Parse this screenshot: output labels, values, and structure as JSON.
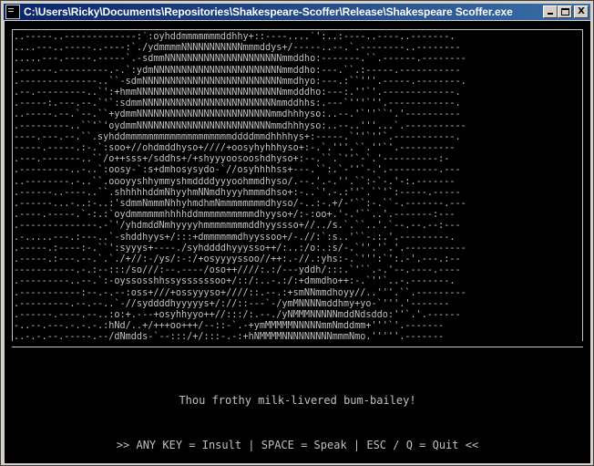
{
  "window": {
    "title": "C:\\Users\\Ricky\\Documents\\Repositories\\Shakespeare-Scoffer\\Release\\Shakespeare Scoffer.exe",
    "buttons": {
      "minimize": "minimize-icon",
      "maximize": "maximize-icon",
      "close_label": "X"
    }
  },
  "console": {
    "ascii_art": "..-----..-------------:`:oyhddmmmmmmmddhhy+::----....`':..:----..----..-------.\n....---..-----..----:`./ydmmmmNNNNNNNNNNNmmmddys+/-----..--.`.--------..--------\n.....---.-----.-----`.-sdmmNNNNNNNNNNNNNNNNNNNNNmmddho:-------.``.------.--------\n.------.---------.-.`:ydmNNNNNNNNNNNNNNNNNNNNNNNmmddho:---.``.:-----.-----------\n.--------------..``-sdmNNNNNNNNNNNNNNNNNNNNNNNNNmmdhyo:---.:``'''.-----.--------.\n.--.---------..`':+hmmNNNNNNNNNNNNNNNNNNNNNNNNNNmmdddho:---:.''`'.-------------.\n.-----:.---.--.`'`:sdmmNNNNNNNNNNNNNNNNNNNNNNNNmmddhhs:.---`'''`''.------------.\n..-----.--.`--.``+ydmmNNNNNNNNNNNNNNNNNNNNNNNNmmdhhhyso:..--.'`''``'.'----------\n.---------..``'`'oydmmNNNNNNNNNNNNNNNNNNNNNNNNmmdhhhyso:..--..'''...`.-----------\n----.---.--.``.syhddmmmmmmmmmmmmmmmmmmmddddmmdhhhhys+:-----.`''`''`.-----------.\n-----.-----.:-.`:soo+//ohdmddhyso+////+oosyhyhhhyso+:-.`.'''.``.''`'.----------\n.---.-------..``/o++sss+/sddhs+/+shyyyoosooshdhyso+:--.``.`''`-`.'----------:-\n.---------..-..`:oosy-`:s+dmhosysydo-`//osyhhhhss+---.``:.`-''`-.'.---------.---\n..--------.-..``.oooyyshhymmyshmddddyyyoohmmdhyso/.--.'.-.''.``:-`-.'-:.-------\n.------..----..``.shhhhhddmNhyyhmNNmdhyyyhmmmdhso+:-..`'.-.:''`.``'`:-----.-----\n.------...-..:-..:'sdmmNmmmNhhyhmdhmNmmmmmmmmdhyso/-..:-.+/-'``:-.``-.-------.---\n.----.-----.`-:.:`oydmmmmmmhhhhddmmmmmmmmmmdhyyso+/:-:oo+.'-.'``..'.-------:---\n.--------------.-`'/yhdmddNmhyyyyhmmmmmmmmddhyyssso+//../s.`.``..'.`--.--.--:---\n.-.....---.:---..`-shddhyys+/:::+dmmmmmmdhyyssoo+/-.//:`:s..'``-.:.'.---------.\n.-----.:----:-.``':syyys+----./syhddddhyyysso++/:..:/o:.:s/-.`''.'`.'.-----------\n.-----.:---.--.`.`./+//:-/ys/:-:/+osyyyyssoo//++:.-//.:yhs:-.`''':`':.-'.---.:--\n-----------.-.:--:::/so///:--.----/oso++////:.:/---yddh/:::.`'``.-.'--.----.----\n.---------..--.`:-oyssosshhssyssssssoo+/::/:..-.:/:+dmmdho++:-.`''`..-.-------.\n.-----------:--.-.--:oss+///+ossyyyso+////::.--.:+smNNmmdhoyy//..'''.``.---------\n.---------.--.--..`-//syddddhyyyyys+/://::---`-/ymMNNNNmddhmy+yo-`'''.'-------\n.------.----.--..:o:+.---+osyhhyyo++//:::/:.--./yNMMMNNNNNmddNdsddo:''`.'.------\n-..--.---.-.-.-.:hNd/..+/+++oo+++/--::-`.-+ymMMMMMNNNNNmmNmddmm+'''`'.-------\n..-.-.--.-----.--/dNmdds-`--:::/+/:::-.-:+hNMMMMNNNNNNNNNmmmNmo.'''''.-------",
    "insult": "Thou frothy milk-livered bum-bailey!",
    "help": ">> ANY KEY = Insult | SPACE = Speak | ESC / Q = Quit <<"
  },
  "colors": {
    "console_background": "#000000",
    "console_text": "#c0c0c0",
    "titlebar_start": "#0a246a",
    "titlebar_end": "#3a6ea5"
  }
}
